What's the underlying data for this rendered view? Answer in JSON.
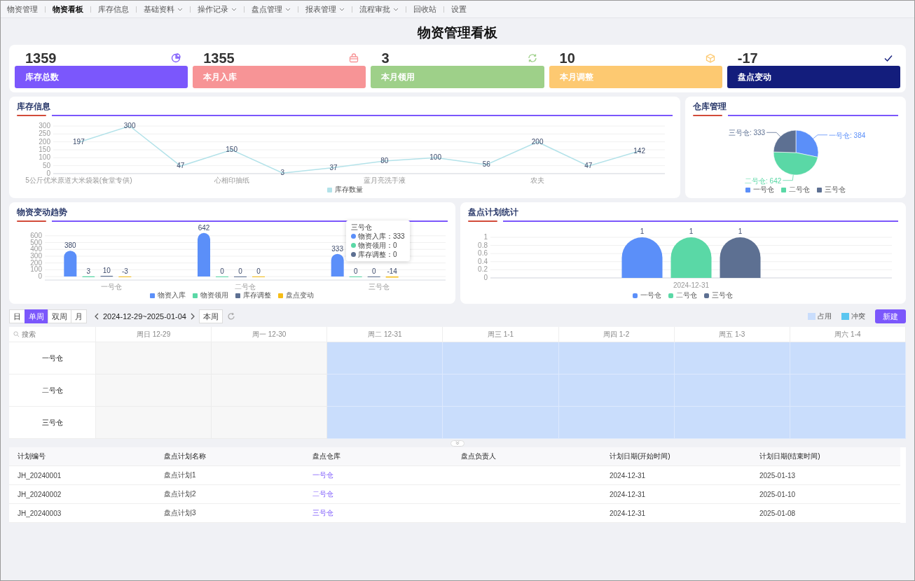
{
  "nav": [
    {
      "label": "物资管理",
      "selected": false,
      "dropdown": false
    },
    {
      "label": "物资看板",
      "selected": true,
      "dropdown": false
    },
    {
      "label": "库存信息",
      "selected": false,
      "dropdown": false
    },
    {
      "label": "基础资料",
      "selected": false,
      "dropdown": true
    },
    {
      "label": "操作记录",
      "selected": false,
      "dropdown": true
    },
    {
      "label": "盘点管理",
      "selected": false,
      "dropdown": true
    },
    {
      "label": "报表管理",
      "selected": false,
      "dropdown": true
    },
    {
      "label": "流程审批",
      "selected": false,
      "dropdown": true
    },
    {
      "label": "回收站",
      "selected": false,
      "dropdown": false
    },
    {
      "label": "设置",
      "selected": false,
      "dropdown": false
    }
  ],
  "title": "物资管理看板",
  "stats": [
    {
      "value": "1359",
      "label": "库存总数",
      "color": "#7b57fc"
    },
    {
      "value": "1355",
      "label": "本月入库",
      "color": "#f79496"
    },
    {
      "value": "3",
      "label": "本月领用",
      "color": "#9ed089"
    },
    {
      "value": "10",
      "label": "本月调整",
      "color": "#fdc971"
    },
    {
      "value": "-17",
      "label": "盘点变动",
      "color": "#131d7c"
    }
  ],
  "stock_panel": {
    "title": "库存信息",
    "chart_data": {
      "type": "line",
      "categories": [
        "5公斤优米原道大米袋装(食堂专供)",
        null,
        null,
        "心相印抽纸",
        null,
        null,
        "蓝月亮洗手液",
        null,
        null,
        "农夫",
        null,
        null
      ],
      "ylim": [
        0,
        300
      ],
      "yticks": [
        0,
        50,
        100,
        150,
        200,
        250,
        300
      ],
      "grid": true,
      "data_labels": true,
      "series": [
        {
          "name": "库存数量",
          "color": "#b3e2e9",
          "values": [
            197,
            300,
            47,
            150,
            3,
            37,
            80,
            100,
            56,
            200,
            47,
            142
          ]
        }
      ]
    }
  },
  "warehouse_panel": {
    "title": "仓库管理",
    "chart_data": {
      "type": "pie",
      "categories": [
        "一号仓",
        "二号仓",
        "三号仓"
      ],
      "values": [
        384,
        642,
        333
      ],
      "colors": [
        "#5b8ff9",
        "#5ad8a6",
        "#5d7092"
      ],
      "value_labels": [
        "一号仓: 384",
        "二号仓: 642",
        "三号仓: 333"
      ]
    }
  },
  "trend_panel": {
    "title": "物资变动趋势",
    "chart_data": {
      "type": "bar",
      "categories": [
        "一号仓",
        "二号仓",
        "三号仓"
      ],
      "ylim": [
        -20,
        660
      ],
      "yticks": [
        0,
        100,
        200,
        300,
        400,
        500,
        600
      ],
      "grid": true,
      "data_labels": true,
      "series": [
        {
          "name": "物资入库",
          "color": "#5b8ff9",
          "values": [
            380,
            642,
            333
          ]
        },
        {
          "name": "物资领用",
          "color": "#5ad8a6",
          "values": [
            3,
            0,
            0
          ]
        },
        {
          "name": "库存调整",
          "color": "#5d7092",
          "values": [
            10,
            0,
            0
          ]
        },
        {
          "name": "盘点变动",
          "color": "#f6bd16",
          "values": [
            -3,
            0,
            -14
          ]
        }
      ]
    },
    "tooltip": {
      "title": "三号仓",
      "lines": [
        {
          "text": "物资入库：333",
          "color": "#5b8ff9"
        },
        {
          "text": "物资领用：0",
          "color": "#5ad8a6"
        },
        {
          "text": "库存调整：0",
          "color": "#5d7092"
        }
      ]
    }
  },
  "plan_panel": {
    "title": "盘点计划统计",
    "chart_data": {
      "type": "bar",
      "categories": [
        "2024-12-31"
      ],
      "ylim": [
        0,
        1
      ],
      "yticks": [
        0,
        0.2,
        0.4,
        0.6,
        0.8,
        1
      ],
      "grid": true,
      "data_labels": true,
      "series": [
        {
          "name": "一号仓",
          "color": "#5b8ff9",
          "values": [
            1
          ]
        },
        {
          "name": "二号仓",
          "color": "#5ad8a6",
          "values": [
            1
          ]
        },
        {
          "name": "三号仓",
          "color": "#5d7092",
          "values": [
            1
          ]
        }
      ]
    }
  },
  "calendar": {
    "views": [
      {
        "label": "日",
        "selected": false
      },
      {
        "label": "单周",
        "selected": true
      },
      {
        "label": "双周",
        "selected": false
      },
      {
        "label": "月",
        "selected": false
      }
    ],
    "range": "2024-12-29~2025-01-04",
    "today": "本周",
    "legend": [
      {
        "label": "占用",
        "color": "#c9ddfc"
      },
      {
        "label": "冲突",
        "color": "#5bc6f0"
      }
    ],
    "new_button": "新建",
    "search": {
      "placeholder": "搜索"
    },
    "days": [
      "周日 12-29",
      "周一 12-30",
      "周二 12-31",
      "周三 1-1",
      "周四 1-2",
      "周五 1-3",
      "周六 1-4"
    ],
    "rows": [
      {
        "name": "一号仓",
        "cells": [
          {
            "occupied": false
          },
          {
            "occupied": false
          },
          {
            "occupied": true
          },
          {
            "occupied": true
          },
          {
            "occupied": true
          },
          {
            "occupied": true
          },
          {
            "occupied": true
          }
        ]
      },
      {
        "name": "二号仓",
        "cells": [
          {
            "occupied": false
          },
          {
            "occupied": false
          },
          {
            "occupied": true
          },
          {
            "occupied": true
          },
          {
            "occupied": true
          },
          {
            "occupied": true
          },
          {
            "occupied": true
          }
        ]
      },
      {
        "name": "三号仓",
        "cells": [
          {
            "occupied": false
          },
          {
            "occupied": false
          },
          {
            "occupied": true
          },
          {
            "occupied": true
          },
          {
            "occupied": true
          },
          {
            "occupied": true
          },
          {
            "occupied": true
          }
        ]
      }
    ]
  },
  "table": {
    "columns": [
      "计划编号",
      "盘点计划名称",
      "盘点仓库",
      "盘点负责人",
      "计划日期(开始时间)",
      "计划日期(结束时间)"
    ],
    "rows": [
      {
        "id": "JH_20240001",
        "name": "盘点计划1",
        "warehouse": "一号仓",
        "start": "2024-12-31",
        "end": "2025-01-13"
      },
      {
        "id": "JH_20240002",
        "name": "盘点计划2",
        "warehouse": "二号仓",
        "start": "2024-12-31",
        "end": "2025-01-10"
      },
      {
        "id": "JH_20240003",
        "name": "盘点计划3",
        "warehouse": "三号仓",
        "start": "2024-12-31",
        "end": "2025-01-08"
      }
    ]
  }
}
